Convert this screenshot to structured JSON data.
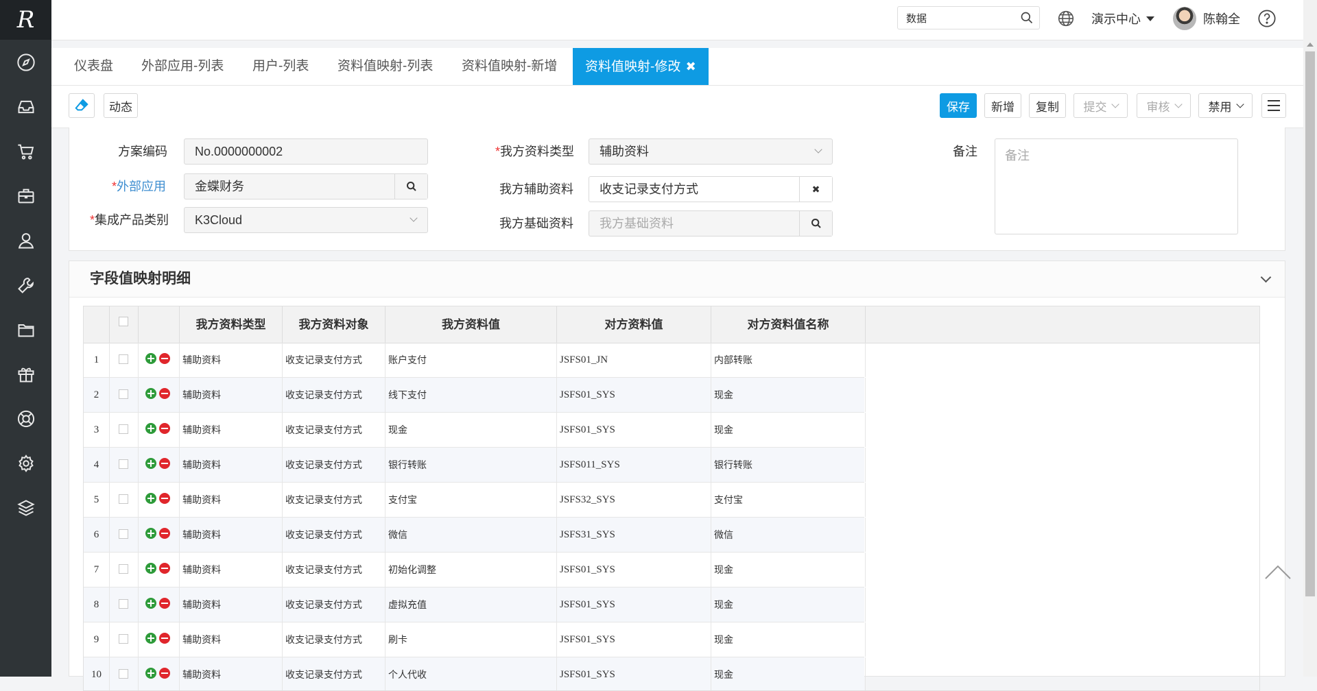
{
  "app": {
    "logo_text": "R"
  },
  "sidebar": {
    "items": [
      {
        "icon": "compass-icon"
      },
      {
        "icon": "inbox-icon"
      },
      {
        "icon": "cart-icon"
      },
      {
        "icon": "briefcase-icon"
      },
      {
        "icon": "user-icon"
      },
      {
        "icon": "wrench-icon"
      },
      {
        "icon": "folder-icon"
      },
      {
        "icon": "gift-icon"
      },
      {
        "icon": "lifebuoy-icon"
      },
      {
        "icon": "gear-icon"
      },
      {
        "icon": "layers-icon"
      }
    ]
  },
  "header": {
    "search_value": "数据",
    "org": "演示中心",
    "user_name": "陈翰全"
  },
  "tabs": [
    {
      "label": "仪表盘"
    },
    {
      "label": "外部应用-列表"
    },
    {
      "label": "用户-列表"
    },
    {
      "label": "资料值映射-列表"
    },
    {
      "label": "资料值映射-新增"
    },
    {
      "label": "资料值映射-修改"
    }
  ],
  "toolbar": {
    "dynamic": "动态",
    "save": "保存",
    "add": "新增",
    "copy": "复制",
    "submit": "提交",
    "audit": "审核",
    "disable": "禁用"
  },
  "form": {
    "scheme_code_label": "方案编码",
    "scheme_code_value": "No.0000000002",
    "ext_app_label": "外部应用",
    "ext_app_value": "金蝶财务",
    "product_label": "集成产品类别",
    "product_value": "K3Cloud",
    "our_type_label": "我方资料类型",
    "our_type_value": "辅助资料",
    "our_aux_label": "我方辅助资料",
    "our_aux_value": "收支记录支付方式",
    "our_base_label": "我方基础资料",
    "our_base_placeholder": "我方基础资料",
    "remark_label": "备注",
    "remark_placeholder": "备注",
    "required_mark": "*"
  },
  "detail": {
    "title": "字段值映射明细",
    "columns": [
      "我方资料类型",
      "我方资料对象",
      "我方资料值",
      "对方资料值",
      "对方资料值名称"
    ],
    "rows": [
      {
        "no": "1",
        "type": "辅助资料",
        "object": "收支记录支付方式",
        "value": "账户支付",
        "their_value": "JSFS01_JN",
        "their_name": "内部转账"
      },
      {
        "no": "2",
        "type": "辅助资料",
        "object": "收支记录支付方式",
        "value": "线下支付",
        "their_value": "JSFS01_SYS",
        "their_name": "现金"
      },
      {
        "no": "3",
        "type": "辅助资料",
        "object": "收支记录支付方式",
        "value": "现金",
        "their_value": "JSFS01_SYS",
        "their_name": "现金"
      },
      {
        "no": "4",
        "type": "辅助资料",
        "object": "收支记录支付方式",
        "value": "银行转账",
        "their_value": "JSFS011_SYS",
        "their_name": "银行转账"
      },
      {
        "no": "5",
        "type": "辅助资料",
        "object": "收支记录支付方式",
        "value": "支付宝",
        "their_value": "JSFS32_SYS",
        "their_name": "支付宝"
      },
      {
        "no": "6",
        "type": "辅助资料",
        "object": "收支记录支付方式",
        "value": "微信",
        "their_value": "JSFS31_SYS",
        "their_name": "微信"
      },
      {
        "no": "7",
        "type": "辅助资料",
        "object": "收支记录支付方式",
        "value": "初始化调整",
        "their_value": "JSFS01_SYS",
        "their_name": "现金"
      },
      {
        "no": "8",
        "type": "辅助资料",
        "object": "收支记录支付方式",
        "value": "虚拟充值",
        "their_value": "JSFS01_SYS",
        "their_name": "现金"
      },
      {
        "no": "9",
        "type": "辅助资料",
        "object": "收支记录支付方式",
        "value": "刷卡",
        "their_value": "JSFS01_SYS",
        "their_name": "现金"
      },
      {
        "no": "10",
        "type": "辅助资料",
        "object": "收支记录支付方式",
        "value": "个人代收",
        "their_value": "JSFS01_SYS",
        "their_name": "现金"
      }
    ]
  }
}
